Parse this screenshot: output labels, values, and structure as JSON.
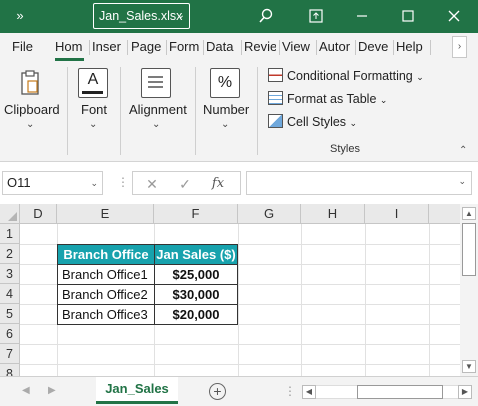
{
  "titlebar": {
    "quick_access": "»",
    "filename": "Jan_Sales.xlsx",
    "search_icon": "search-icon",
    "restore_icon": "ribbon-display-icon",
    "minimize_icon": "minimize-icon",
    "maximize_icon": "maximize-icon",
    "close_icon": "close-icon",
    "background": "#217346"
  },
  "tabs": [
    {
      "label": "File"
    },
    {
      "label": "Hom"
    },
    {
      "label": "Inser"
    },
    {
      "label": "Page"
    },
    {
      "label": "Form"
    },
    {
      "label": "Data"
    },
    {
      "label": "Revie"
    },
    {
      "label": "View"
    },
    {
      "label": "Autor"
    },
    {
      "label": "Deve"
    },
    {
      "label": "Help"
    }
  ],
  "active_tab": "Hom",
  "ribbon": {
    "clipboard": "Clipboard",
    "font": "Font",
    "alignment": "Alignment",
    "number": "Number",
    "number_symbol": "%",
    "font_symbol": "A",
    "conditional_formatting": "Conditional Formatting",
    "format_as_table": "Format as Table",
    "cell_styles": "Cell Styles",
    "styles_group": "Styles"
  },
  "formula_bar": {
    "name_box": "O11",
    "fx": "fx",
    "cancel": "✕",
    "enter": "✓",
    "formula": ""
  },
  "columns": [
    "D",
    "E",
    "F",
    "G",
    "H",
    "I"
  ],
  "rows": [
    "1",
    "2",
    "3",
    "4",
    "5",
    "6",
    "7",
    "8"
  ],
  "table": {
    "headers": [
      "Branch Office",
      "Jan Sales ($)"
    ],
    "rows": [
      [
        "Branch Office1",
        "$25,000"
      ],
      [
        "Branch Office2",
        "$30,000"
      ],
      [
        "Branch Office3",
        "$20,000"
      ]
    ],
    "header_color": "#17a2ad"
  },
  "sheets": {
    "active": "Jan_Sales",
    "add_label": "+"
  },
  "accent_color": "#217346"
}
